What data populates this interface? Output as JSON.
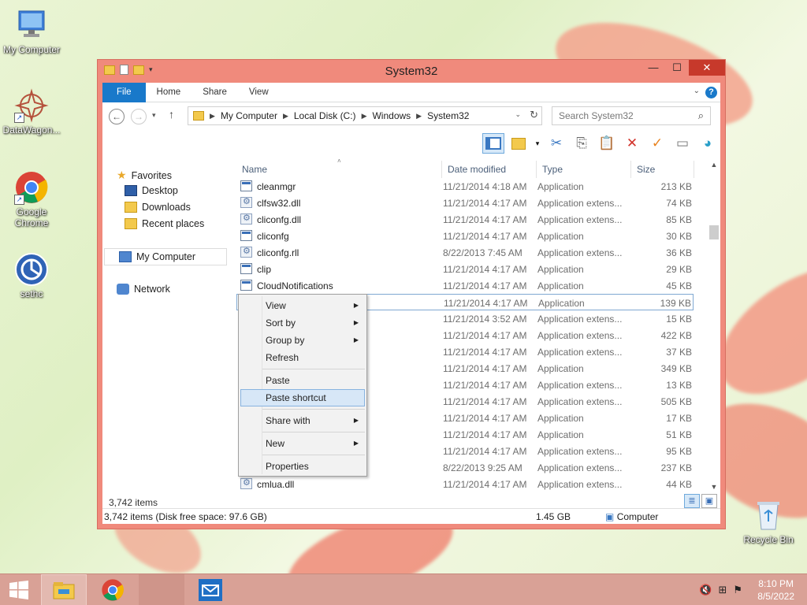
{
  "desktop": {
    "icons": [
      {
        "label": "My Computer"
      },
      {
        "label": "DataWagon..."
      },
      {
        "label": "Google Chrome"
      },
      {
        "label": "sethc"
      },
      {
        "label": "Recycle Bin"
      }
    ]
  },
  "window": {
    "title": "System32",
    "ribbon_tabs": [
      "File",
      "Home",
      "Share",
      "View"
    ],
    "help": "?",
    "address": {
      "crumbs": [
        "My Computer",
        "Local Disk (C:)",
        "Windows",
        "System32"
      ]
    },
    "search": {
      "placeholder": "Search System32"
    },
    "nav": {
      "favorites": "Favorites",
      "desktop": "Desktop",
      "downloads": "Downloads",
      "recent": "Recent places",
      "my_computer": "My Computer",
      "network": "Network"
    },
    "columns": {
      "name": "Name",
      "date": "Date modified",
      "type": "Type",
      "size": "Size"
    },
    "rows": [
      {
        "name": "cleanmgr",
        "date": "11/21/2014 4:18 AM",
        "type": "Application",
        "size": "213 KB",
        "icon": "app"
      },
      {
        "name": "clfsw32.dll",
        "date": "11/21/2014 4:17 AM",
        "type": "Application extens...",
        "size": "74 KB",
        "icon": "dll"
      },
      {
        "name": "cliconfg.dll",
        "date": "11/21/2014 4:17 AM",
        "type": "Application extens...",
        "size": "85 KB",
        "icon": "dll"
      },
      {
        "name": "cliconfg",
        "date": "11/21/2014 4:17 AM",
        "type": "Application",
        "size": "30 KB",
        "icon": "app"
      },
      {
        "name": "cliconfg.rll",
        "date": "8/22/2013 7:45 AM",
        "type": "Application extens...",
        "size": "36 KB",
        "icon": "dll"
      },
      {
        "name": "clip",
        "date": "11/21/2014 4:17 AM",
        "type": "Application",
        "size": "29 KB",
        "icon": "app"
      },
      {
        "name": "CloudNotifications",
        "date": "11/21/2014 4:17 AM",
        "type": "Application",
        "size": "45 KB",
        "icon": "app"
      },
      {
        "name": "",
        "date": "11/21/2014 4:17 AM",
        "type": "Application",
        "size": "139 KB",
        "icon": "app"
      },
      {
        "name": "",
        "date": "11/21/2014 3:52 AM",
        "type": "Application extens...",
        "size": "15 KB",
        "icon": "dll"
      },
      {
        "name": "",
        "date": "11/21/2014 4:17 AM",
        "type": "Application extens...",
        "size": "422 KB",
        "icon": "dll"
      },
      {
        "name": "",
        "date": "11/21/2014 4:17 AM",
        "type": "Application extens...",
        "size": "37 KB",
        "icon": "dll"
      },
      {
        "name": "",
        "date": "11/21/2014 4:17 AM",
        "type": "Application",
        "size": "349 KB",
        "icon": "app"
      },
      {
        "name": "",
        "date": "11/21/2014 4:17 AM",
        "type": "Application extens...",
        "size": "13 KB",
        "icon": "dll"
      },
      {
        "name": "",
        "date": "11/21/2014 4:17 AM",
        "type": "Application extens...",
        "size": "505 KB",
        "icon": "dll"
      },
      {
        "name": "",
        "date": "11/21/2014 4:17 AM",
        "type": "Application",
        "size": "17 KB",
        "icon": "app"
      },
      {
        "name": "",
        "date": "11/21/2014 4:17 AM",
        "type": "Application",
        "size": "51 KB",
        "icon": "app"
      },
      {
        "name": "",
        "date": "11/21/2014 4:17 AM",
        "type": "Application extens...",
        "size": "95 KB",
        "icon": "dll"
      },
      {
        "name": "",
        "date": "8/22/2013 9:25 AM",
        "type": "Application extens...",
        "size": "237 KB",
        "icon": "dll"
      },
      {
        "name": "cmlua.dll",
        "date": "11/21/2014 4:17 AM",
        "type": "Application extens...",
        "size": "44 KB",
        "icon": "dll"
      }
    ],
    "item_count": "3,742 items",
    "status": {
      "items": "3,742 items (Disk free space: 97.6 GB)",
      "size": "1.45 GB",
      "location": "Computer"
    }
  },
  "context_menu": {
    "items": [
      "View",
      "Sort by",
      "Group by",
      "Refresh",
      "Paste",
      "Paste shortcut",
      "Share with",
      "New",
      "Properties"
    ]
  },
  "taskbar": {
    "time": "8:10 PM",
    "date": "8/5/2022"
  },
  "colors": {
    "window_frame": "#f08a7c",
    "accent": "#1979ca",
    "close": "#c7392b",
    "taskbar": "#d9a196"
  }
}
